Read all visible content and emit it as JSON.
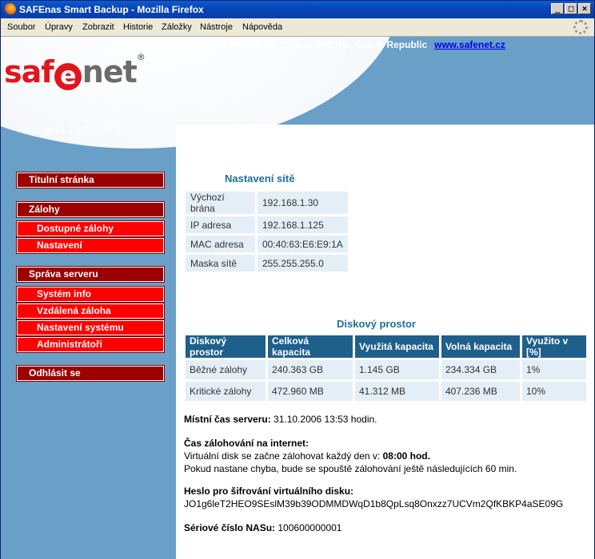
{
  "window": {
    "title": "SAFEnas Smart Backup - Mozilla Firefox"
  },
  "menu": [
    "Soubor",
    "Úpravy",
    "Zobrazit",
    "Historie",
    "Záložky",
    "Nástroje",
    "Nápověda"
  ],
  "header": {
    "logo_pre": "saf",
    "logo_e": "e",
    "logo_post": "net",
    "logo_reg": "®",
    "address": "s.r.o. Pražákova 10, 619 00 Brno, Czech Republic",
    "website": "www.safenet.cz",
    "version": "Verze 1.0.0 build 1006"
  },
  "nav": {
    "home": "Titulní stránka",
    "backups": "Zálohy",
    "available_backups": "Dostupné zálohy",
    "settings": "Nastavení",
    "server_mgmt": "Správa serveru",
    "system_info": "Systém info",
    "remote_backup": "Vzdálená záloha",
    "system_settings": "Nastavení systému",
    "admins": "Administrátoři",
    "logout": "Odhlásit se"
  },
  "network": {
    "title": "Nastavení sítě",
    "rows": [
      {
        "label": "Výchozí brána",
        "value": "192.168.1.30"
      },
      {
        "label": "IP adresa",
        "value": "192.168.1.125"
      },
      {
        "label": "MAC adresa",
        "value": "00:40:63:E6:E9:1A"
      },
      {
        "label": "Maska sítě",
        "value": "255.255.255.0"
      }
    ]
  },
  "disk": {
    "title": "Diskový prostor",
    "headers": [
      "Diskový prostor",
      "Celková kapacita",
      "Využitá kapacita",
      "Volná kapacita",
      "Využito v [%]"
    ],
    "rows": [
      [
        "Běžné zálohy",
        "240.363 GB",
        "1.145 GB",
        "234.334 GB",
        "1%"
      ],
      [
        "Kritické zálohy",
        "472.960 MB",
        "41.312 MB",
        "407.236 MB",
        "10%"
      ]
    ]
  },
  "info": {
    "time_label": "Místní čas serveru:",
    "time_value": " 31.10.2006 13:53 hodin.",
    "backup_label": "Čas zálohování na internet:",
    "backup_line1_pre": "Virtuální disk se začne zálohovat každý den v: ",
    "backup_time": "08:00 hod.",
    "backup_line2": "Pokud nastane chyba, bude se spouště zálohování ještě následujících 60 min.",
    "password_label": "Heslo pro šifrování virtuálního disku:",
    "password_value": "JO1g6leT2HEO9SEslM39b39ODMMDWqD1b8QpLsq8Onxzz7UCVm2QfKBKP4aSE09G",
    "serial_label": "Sériové číslo NASu:",
    "serial_value": " 100600000001"
  }
}
